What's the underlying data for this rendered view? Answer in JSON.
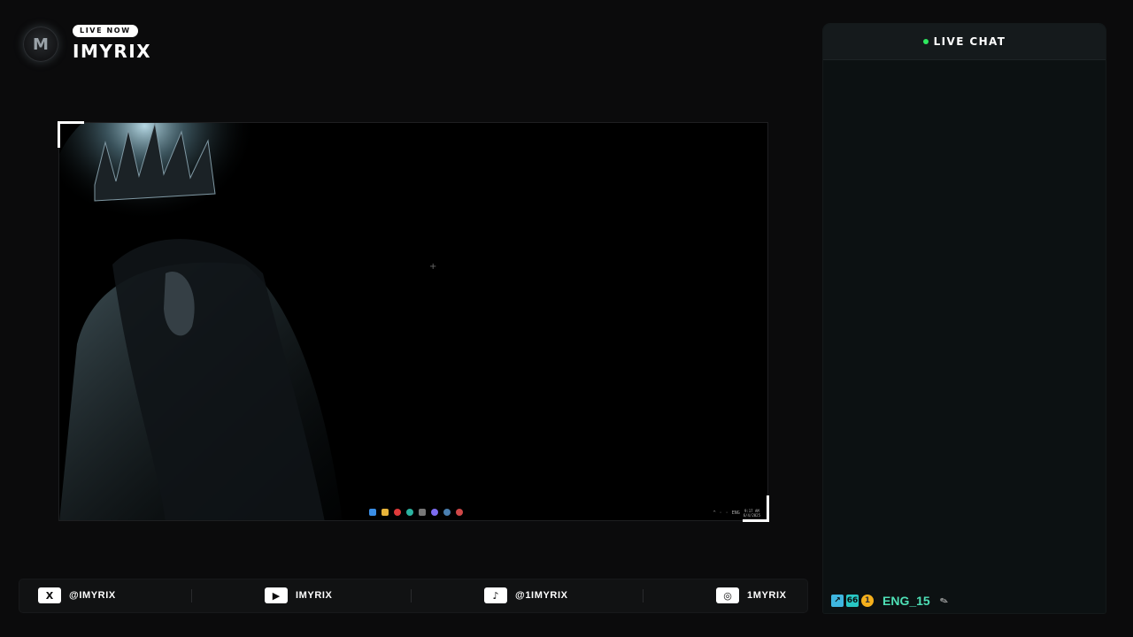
{
  "brand": {
    "logo_letter": "M",
    "live_badge": "LIVE NOW",
    "name": "IMYRIX"
  },
  "stream": {
    "cursor_glyph": "+",
    "taskbar_icons": [
      "windows-icon",
      "files-icon",
      "opera-icon",
      "edge-icon",
      "app-icon",
      "discord-icon",
      "steam-icon",
      "app-icon-2"
    ],
    "tray": {
      "language": "ENG",
      "time": "9:17 AM",
      "date": "6/4/2025"
    }
  },
  "chat": {
    "title": "LIVE CHAT",
    "status_color": "#2ee85f",
    "message": {
      "badges": [
        "moderator-badge",
        "tier-badge",
        "subscriber-badge"
      ],
      "badge_b_text": "66",
      "badge_c_text": "1",
      "username": "ENG_15",
      "username_color": "#4ee0b6",
      "emote": "feather-emote"
    }
  },
  "socials": [
    {
      "platform": "x",
      "icon_glyph": "X",
      "handle": "@IMYRIX"
    },
    {
      "platform": "youtube",
      "icon_glyph": "▶",
      "handle": "IMYRIX"
    },
    {
      "platform": "tiktok",
      "icon_glyph": "♪",
      "handle": "@1IMYRIX"
    },
    {
      "platform": "instagram",
      "icon_glyph": "◎",
      "handle": "1MYRIX"
    }
  ]
}
